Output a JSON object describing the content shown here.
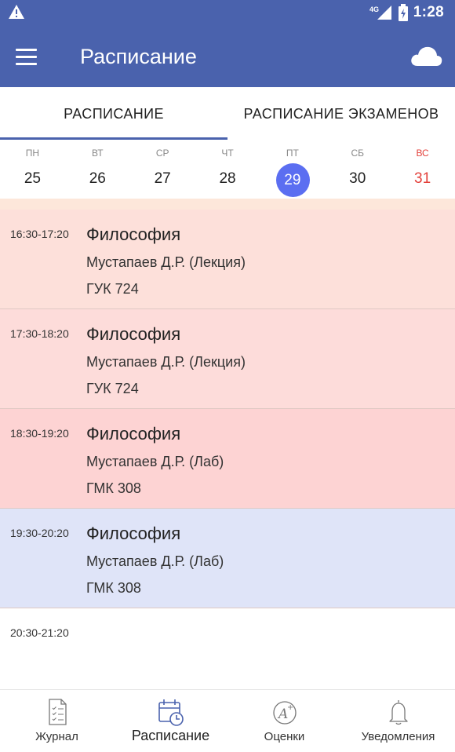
{
  "status_bar": {
    "network": "4G",
    "time": "1:28"
  },
  "app_bar": {
    "title": "Расписание",
    "menu_icon": "hamburger-menu-icon",
    "action_icon": "cloud-icon"
  },
  "tabs": [
    {
      "label": "РАСПИСАНИЕ",
      "active": true
    },
    {
      "label": "РАСПИСАНИЕ ЭКЗАМЕНОВ",
      "active": false
    }
  ],
  "week": [
    {
      "name": "ПН",
      "num": "25"
    },
    {
      "name": "ВТ",
      "num": "26"
    },
    {
      "name": "СР",
      "num": "27"
    },
    {
      "name": "ЧТ",
      "num": "28"
    },
    {
      "name": "ПТ",
      "num": "29",
      "selected": true
    },
    {
      "name": "СБ",
      "num": "30"
    },
    {
      "name": "ВС",
      "num": "31",
      "sunday": true
    }
  ],
  "schedule": [
    {
      "time": "16:30-17:20",
      "subject": "Философия",
      "teacher": "Мустапаев Д.Р. (Лекция)",
      "room": "ГУК 724",
      "color": "#fde0da"
    },
    {
      "time": "17:30-18:20",
      "subject": "Философия",
      "teacher": "Мустапаев Д.Р. (Лекция)",
      "room": "ГУК 724",
      "color": "#fddcda"
    },
    {
      "time": "18:30-19:20",
      "subject": "Философия",
      "teacher": "Мустапаев Д.Р. (Лаб)",
      "room": "ГМК 308",
      "color": "#fdd3d3"
    },
    {
      "time": "19:30-20:20",
      "subject": "Философия",
      "teacher": "Мустапаев Д.Р. (Лаб)",
      "room": "ГМК 308",
      "color": "#dfe4f8"
    },
    {
      "time": "20:30-21:20",
      "subject": "",
      "teacher": "",
      "room": "",
      "color": "#ffffff"
    }
  ],
  "bottom_nav": [
    {
      "label": "Журнал",
      "icon": "journal-icon"
    },
    {
      "label": "Расписание",
      "icon": "calendar-clock-icon",
      "active": true
    },
    {
      "label": "Оценки",
      "icon": "grade-icon"
    },
    {
      "label": "Уведомления",
      "icon": "bell-icon"
    }
  ],
  "colors": {
    "primary": "#4a62ad",
    "selected_day": "#5b6ef1",
    "sunday": "#e3413b"
  }
}
